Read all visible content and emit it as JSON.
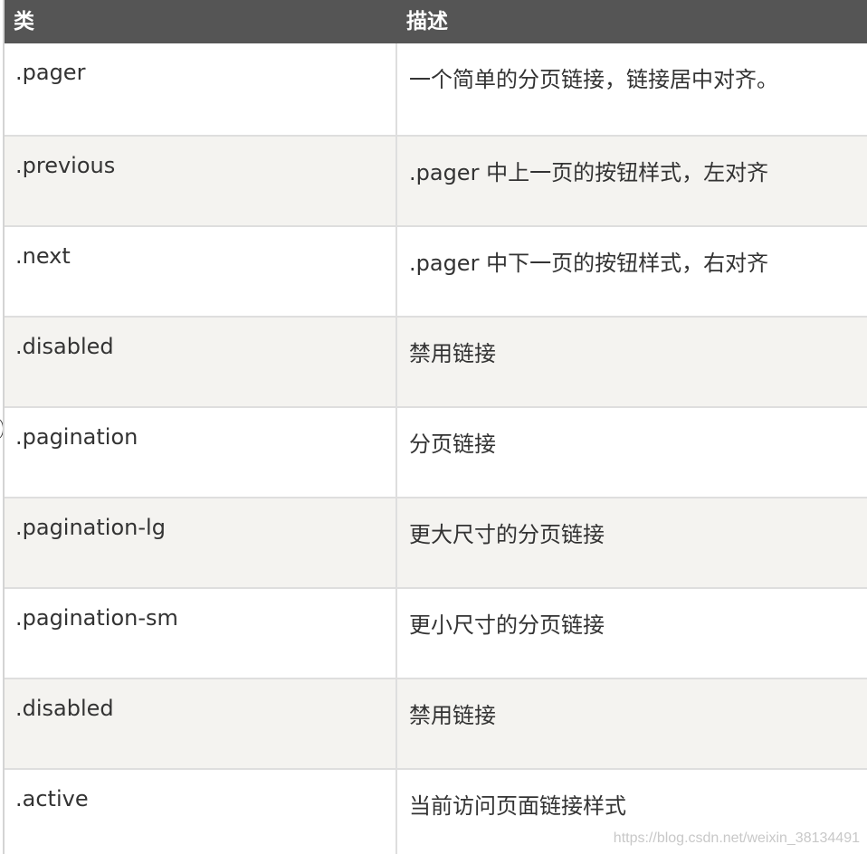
{
  "header": {
    "col_class": "类",
    "col_desc": "描述"
  },
  "rows": [
    {
      "cls": ".pager",
      "desc": "一个简单的分页链接，链接居中对齐。"
    },
    {
      "cls": ".previous",
      "desc": ".pager 中上一页的按钮样式，左对齐"
    },
    {
      "cls": ".next",
      "desc": ".pager 中下一页的按钮样式，右对齐"
    },
    {
      "cls": ".disabled",
      "desc": "禁用链接"
    },
    {
      "cls": ".pagination",
      "desc": "分页链接"
    },
    {
      "cls": ".pagination-lg",
      "desc": "更大尺寸的分页链接"
    },
    {
      "cls": ".pagination-sm",
      "desc": "更小尺寸的分页链接"
    },
    {
      "cls": ".disabled",
      "desc": "禁用链接"
    },
    {
      "cls": ".active",
      "desc": "当前访问页面链接样式"
    }
  ],
  "watermark": "https://blog.csdn.net/weixin_38134491"
}
